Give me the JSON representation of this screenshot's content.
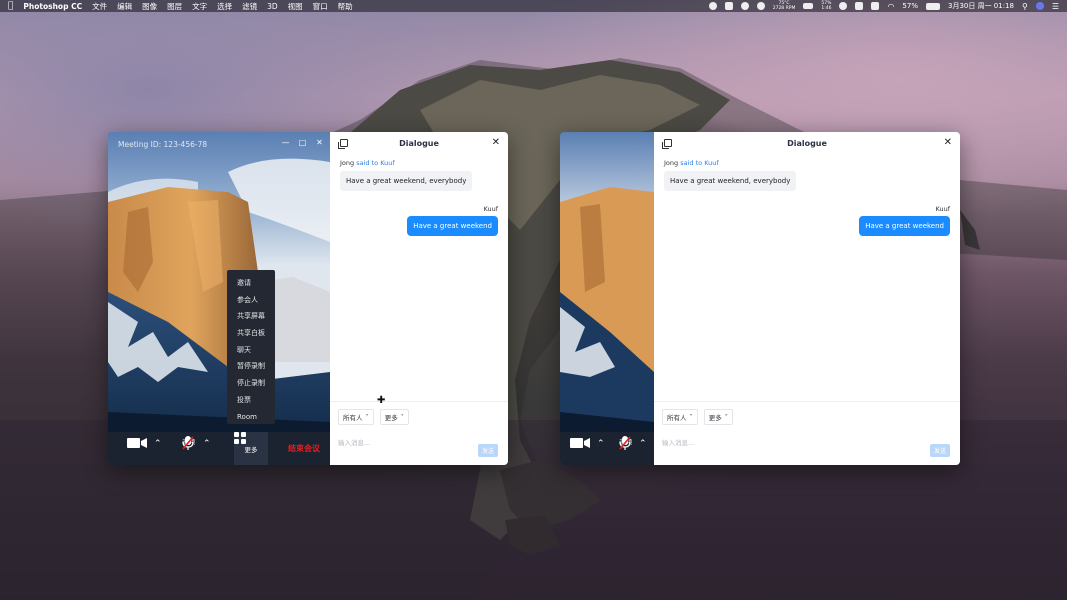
{
  "menubar": {
    "app_name": "Photoshop CC",
    "menus": [
      "文件",
      "编辑",
      "图像",
      "图层",
      "文字",
      "选择",
      "滤镜",
      "3D",
      "视图",
      "窗口",
      "帮助"
    ],
    "temp": "75°C",
    "rpm": "2728 RPM",
    "battery_small": "57%",
    "battery_time": "1:46",
    "battery_pct": "57%",
    "datetime": "3月30日 周一  01:18"
  },
  "window1": {
    "meeting_id": "Meeting ID: 123-456-78",
    "toolbar": {
      "video_label": "视频",
      "audio_label": "音频",
      "more_label": "更多",
      "end_label": "结束会议"
    },
    "more_menu": [
      "邀请",
      "参会人",
      "共享屏幕",
      "共享白板",
      "聊天",
      "暂停录制",
      "停止录制",
      "投票",
      "Room"
    ],
    "chat": {
      "title": "Dialogue",
      "msg1_sender": "Jong",
      "msg1_mid": "said to",
      "msg1_target": "Kuuf",
      "msg1_text": "Have a great weekend, everybody",
      "msg2_sender": "Kuuf",
      "msg2_text": "Have a great weekend",
      "recipient_dropdown": "所有人",
      "more_dropdown": "更多",
      "input_placeholder": "输入消息...",
      "send_label": "发送"
    }
  },
  "window2": {
    "toolbar": {
      "video_label": "视频",
      "audio_label": "音频"
    },
    "chat": {
      "title": "Dialogue",
      "msg1_sender": "Jong",
      "msg1_mid": "said to",
      "msg1_target": "Kuuf",
      "msg1_text": "Have a great weekend, everybody",
      "msg2_sender": "Kuuf",
      "msg2_text": "Have a great weekend",
      "recipient_dropdown": "所有人",
      "more_dropdown": "更多",
      "input_placeholder": "输入消息...",
      "send_label": "发送"
    }
  },
  "colors": {
    "accent": "#1a8cff",
    "toolbar_bg": "#1b2230",
    "end_red": "#e02020",
    "link_blue": "#2f7de1"
  }
}
